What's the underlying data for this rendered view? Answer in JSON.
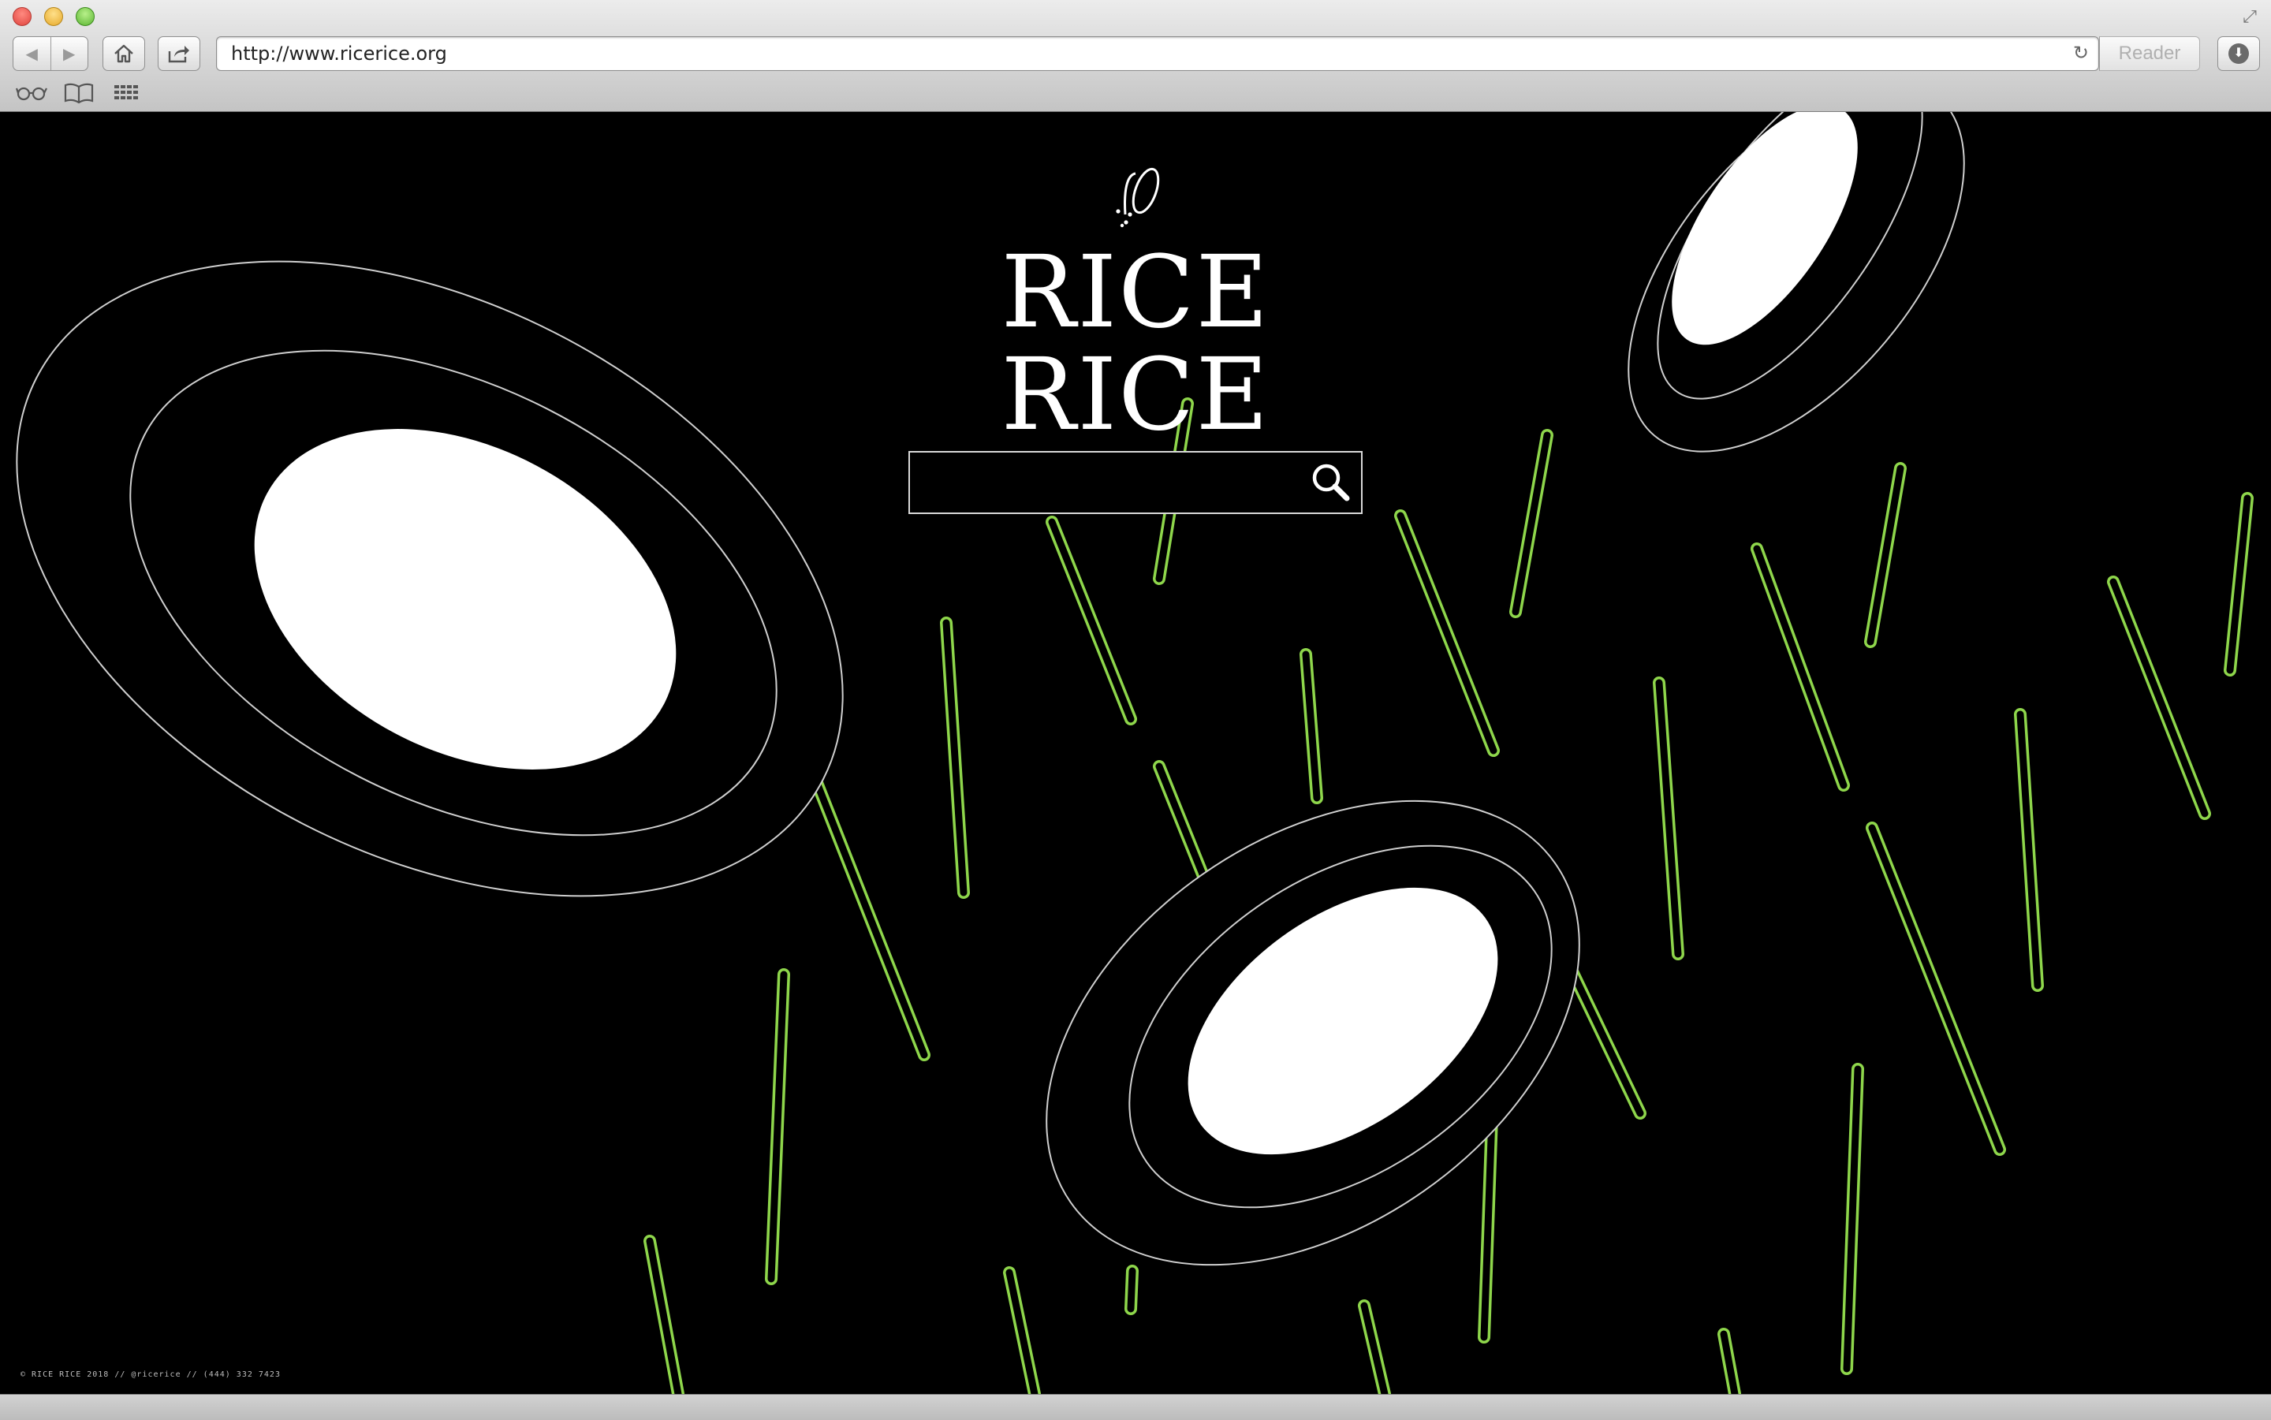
{
  "browser": {
    "url": "http://www.ricerice.org",
    "reader_label": "Reader",
    "back_icon": "◀",
    "forward_icon": "▶",
    "home_icon": "⌂",
    "share_icon": "⇪",
    "reload_icon": "↻",
    "download_icon": "⬇",
    "fullscreen_icon": "⤢",
    "reading_list_icon": "👓",
    "bookmarks_icon": "📖",
    "top_sites_icon": "▦"
  },
  "site": {
    "brand_name": "RICE RICE",
    "search_placeholder": "",
    "footer": "© RICE RICE 2018 // @ricerice // (444) 332 7423"
  },
  "colors": {
    "background": "#000000",
    "grain_stroke": "#8ed64b",
    "outline": "#cfcfcf",
    "rice_fill": "#ffffff"
  }
}
